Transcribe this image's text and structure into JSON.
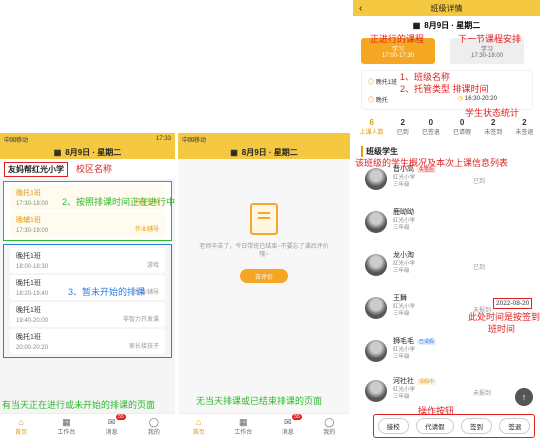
{
  "screen1": {
    "status_left": "中国移动",
    "status_right": "17:33",
    "date": "8月9日 · 星期二",
    "school": "友妈帮红光小学",
    "courses_current": [
      {
        "name": "晚托1班",
        "time": "17:30-18:00",
        "tag": "托管签到"
      },
      {
        "name": "晚辅1班",
        "time": "17:30-19:00",
        "tag": "作业辅导"
      }
    ],
    "courses_upcoming": [
      {
        "name": "晚托1班",
        "time": "18:00-18:30",
        "tag": "游戏"
      },
      {
        "name": "晚托1班",
        "time": "18:20-19:40",
        "tag": "作业辅导"
      },
      {
        "name": "晚托1班",
        "time": "19:40-20:00",
        "tag": "非智力开发课"
      },
      {
        "name": "晚托1班",
        "time": "20:00-20:20",
        "tag": "家长接孩子"
      }
    ],
    "tabs": [
      {
        "label": "首页",
        "icon": "⌂"
      },
      {
        "label": "工作台",
        "icon": "▦"
      },
      {
        "label": "消息",
        "icon": "✉",
        "badge": "55"
      },
      {
        "label": "我的",
        "icon": "◯"
      }
    ]
  },
  "screen2": {
    "status_left": "中国移动",
    "date": "8月9日 · 星期二",
    "empty_text": "老师辛苦了，今日带班已结束~不要忘了课后评价哦~",
    "eval_button": "去评价",
    "tabs": [
      {
        "label": "首页",
        "icon": "⌂"
      },
      {
        "label": "工作台",
        "icon": "▦"
      },
      {
        "label": "消息",
        "icon": "✉",
        "badge": "55"
      },
      {
        "label": "我的",
        "icon": "◯"
      }
    ]
  },
  "screen3": {
    "title": "班级详情",
    "date": "8月9日 · 星期二",
    "course_current": {
      "name": "学习",
      "time": "17:00-17:30"
    },
    "course_next": {
      "name": "学习",
      "time": "17:30-18:00"
    },
    "detail": {
      "class": "晚托1班",
      "type": "晚托",
      "time": "16:30-20:20"
    },
    "stats": [
      {
        "num": "6",
        "label": "上课人数"
      },
      {
        "num": "2",
        "label": "已到"
      },
      {
        "num": "0",
        "label": "已签退"
      },
      {
        "num": "0",
        "label": "已请假"
      },
      {
        "num": "2",
        "label": "未签到"
      },
      {
        "num": "2",
        "label": "未签退"
      }
    ],
    "section": "班级学生",
    "students": [
      {
        "name": "晋小高",
        "tag": "失签后",
        "school": "红光小学",
        "grade": "三年级",
        "status": "已到",
        "time": ""
      },
      {
        "name": "鹿呦呦",
        "tag": "",
        "school": "红光小学",
        "grade": "三年级",
        "status": "",
        "time": ""
      },
      {
        "name": "龙小淘",
        "tag": "",
        "school": "红光小学",
        "grade": "三年级",
        "status": "已到",
        "time": ""
      },
      {
        "name": "王舞",
        "tag": "",
        "school": "红光小学",
        "grade": "三年级",
        "status": "未报到",
        "time": "2022-08-20"
      },
      {
        "name": "狮毛毛",
        "tag": "已请假",
        "school": "红光小学",
        "grade": "三年级",
        "status": "",
        "time": ""
      },
      {
        "name": "河社社",
        "tag": "请假中",
        "school": "红光小学",
        "grade": "三年级",
        "status": "未报到",
        "time": ""
      }
    ],
    "actions": [
      "接校",
      "代请假",
      "签到",
      "签退"
    ]
  },
  "annotations": {
    "campus_name": "校区名称",
    "schedule_current": "2、按照排课时间正在进行中",
    "schedule_future": "3、暂未开始的排课",
    "s1_caption": "有当天正在进行或未开始的排课的页面",
    "s2_caption": "无当天排课或已结束排课的页面",
    "ongoing_course": "正进行的课程",
    "next_course": "下一节课程安排",
    "class_info_1": "1、班级名称",
    "class_info_2": "2、托管类型  排课时间",
    "status_stats": "学生状态统计",
    "student_overview": "该班级的学生概况及本次上课信息列表",
    "enroll_time": "此处时间是按签到",
    "enroll_time_2": "班时间",
    "action_buttons": "操作按钮"
  }
}
